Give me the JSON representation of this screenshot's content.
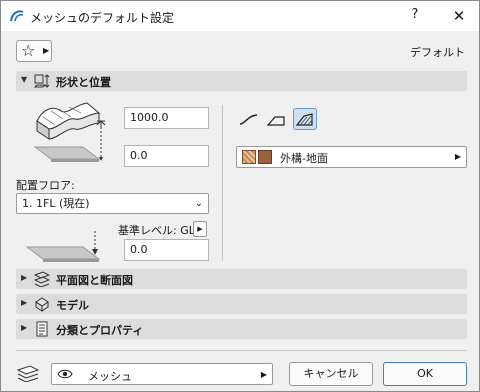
{
  "window": {
    "title": "メッシュのデフォルト設定",
    "help": "?",
    "close": "✕"
  },
  "header": {
    "favorites_icon": "star-icon",
    "default_label": "デフォルト"
  },
  "sections": {
    "shape": {
      "title": "形状と位置",
      "icon": "shape-position-icon",
      "expanded": true
    },
    "plan": {
      "title": "平面図と断面図",
      "icon": "plan-section-icon",
      "expanded": false
    },
    "model": {
      "title": "モデル",
      "icon": "model-icon",
      "expanded": false
    },
    "classification": {
      "title": "分類とプロパティ",
      "icon": "classification-icon",
      "expanded": false
    }
  },
  "shape": {
    "height_value": "1000.0",
    "offset_value": "0.0",
    "floor_label": "配置フロア:",
    "floor_selected": "1. 1FL (現在)",
    "base_level_label": "基準レベル: GL",
    "base_level_value": "0.0",
    "material_name": "外構-地面",
    "active_geometry": "ridges-all-sharp"
  },
  "footer": {
    "layer_name": "メッシュ",
    "cancel_label": "キャンセル",
    "ok_label": "OK"
  },
  "colors": {
    "accent": "#3c7fc8",
    "section_bg": "#dcdcdc",
    "active_button": "#cfe0f2"
  }
}
